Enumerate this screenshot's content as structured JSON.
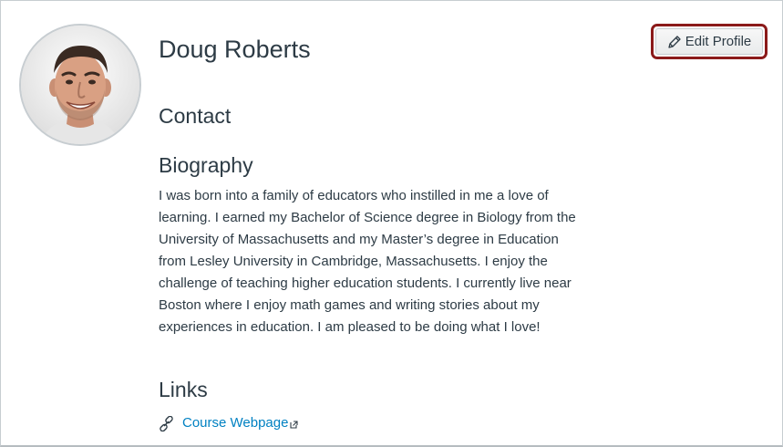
{
  "profile": {
    "name": "Doug Roberts",
    "edit_button_label": "Edit Profile"
  },
  "sections": {
    "contact_title": "Contact",
    "biography_title": "Biography",
    "biography_text": "I was born into a family of educators who instilled in me a love of learning. I earned my Bachelor of Science degree in Biology from the University of Massachusetts and my Master’s degree in Education from Lesley University in Cambridge, Massachusetts. I enjoy the challenge of teaching higher education students. I currently live near Boston where I enjoy math games and writing stories about my experiences in education. I am pleased to be doing what I love!",
    "links_title": "Links"
  },
  "links": [
    {
      "label": "Course Webpage"
    }
  ],
  "icons": {
    "edit": "pencil-icon",
    "link": "chain-link-icon",
    "external": "external-link-icon"
  },
  "colors": {
    "text": "#2d3b45",
    "link": "#0081c2",
    "focus_border": "#8b1a1a"
  }
}
